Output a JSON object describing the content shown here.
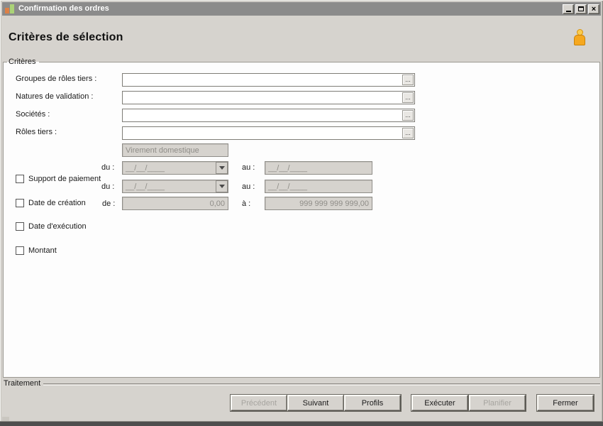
{
  "titlebar": {
    "title": "Confirmation des ordres"
  },
  "header": {
    "title": "Critères de sélection"
  },
  "criteria": {
    "legend": "Critères",
    "ellipsis": "...",
    "lookups": [
      {
        "label": "Groupes de rôles tiers :",
        "value": ""
      },
      {
        "label": "Natures de validation :",
        "value": ""
      },
      {
        "label": "Sociétés :",
        "value": ""
      },
      {
        "label": "Rôles tiers :",
        "value": ""
      }
    ],
    "payment_nature": "Virement domestique",
    "du_label": "du :",
    "au_label": "au :",
    "de_label": "de :",
    "a_label": "à :",
    "date_mask": "__/__/____",
    "amount_min": "0,00",
    "amount_max": "999 999 999 999,00",
    "checkboxes": [
      {
        "label": "Support de paiement",
        "checked": false
      },
      {
        "label": "Date de création",
        "checked": false
      },
      {
        "label": "Date d'exécution",
        "checked": false
      },
      {
        "label": "Montant",
        "checked": false
      }
    ]
  },
  "footer": {
    "legend": "Traitement",
    "buttons": [
      {
        "label": "Précédent",
        "enabled": false
      },
      {
        "label": "Suivant",
        "enabled": true
      },
      {
        "label": "Profils",
        "enabled": true
      },
      {
        "label": "Exécuter",
        "enabled": true
      },
      {
        "label": "Planifier",
        "enabled": false
      },
      {
        "label": "Fermer",
        "enabled": true
      }
    ]
  },
  "colors": {
    "chrome": "#d6d3ce",
    "titlebar": "#8b8b8b",
    "accent_orange": "#f6a81f",
    "icon_green": "#abd377",
    "icon_orange": "#dd8047"
  }
}
